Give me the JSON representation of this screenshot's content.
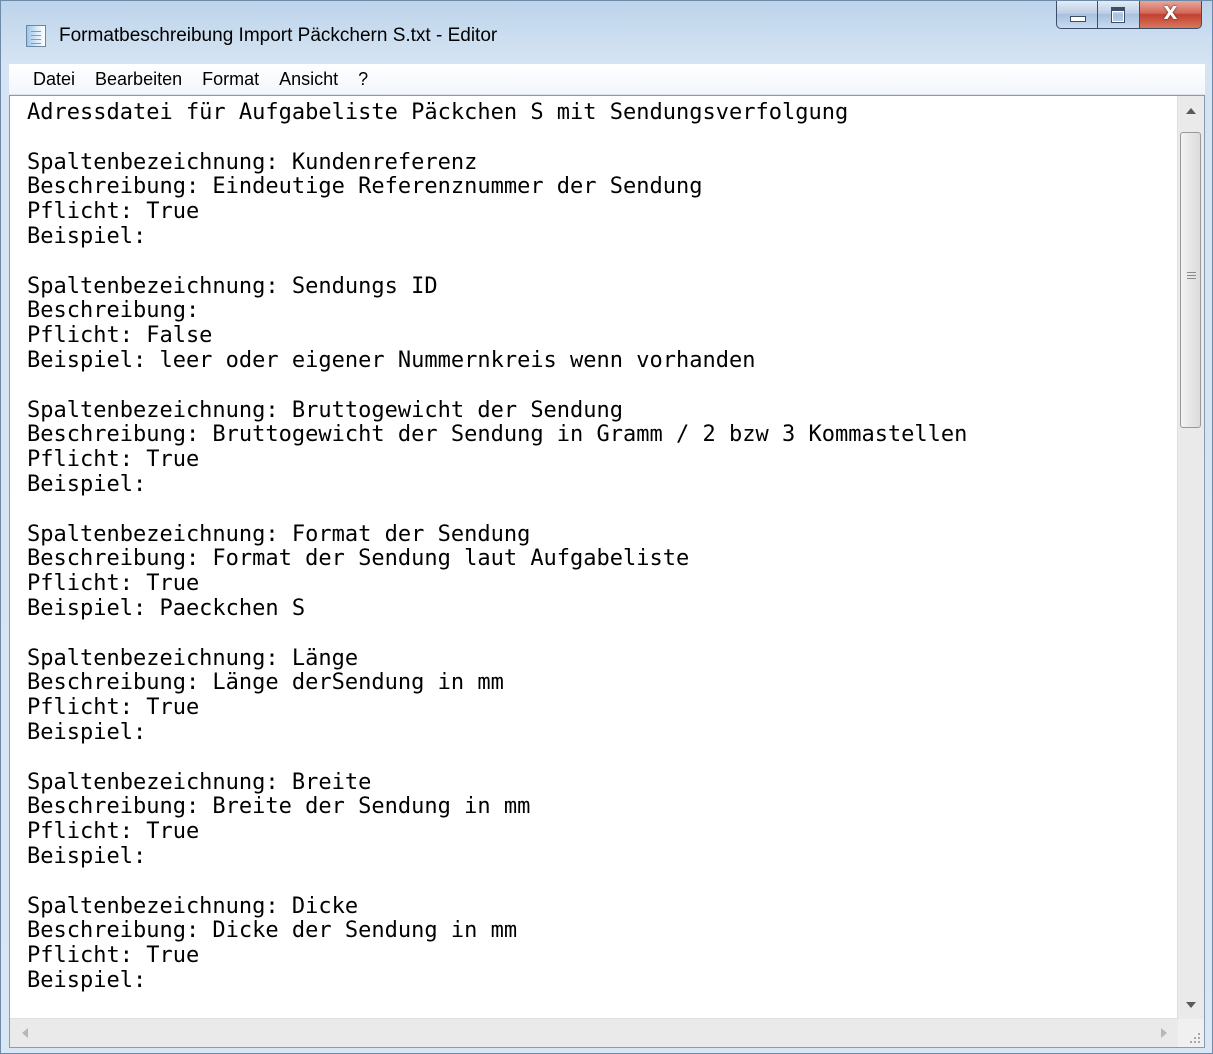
{
  "window": {
    "title": "Formatbeschreibung Import Päckchern S.txt - Editor",
    "close_glyph": "X"
  },
  "menu": {
    "items": [
      {
        "label": "Datei"
      },
      {
        "label": "Bearbeiten"
      },
      {
        "label": "Format"
      },
      {
        "label": "Ansicht"
      },
      {
        "label": "?"
      }
    ]
  },
  "document": {
    "lines": [
      "Adressdatei für Aufgabeliste Päckchen S mit Sendungsverfolgung",
      "",
      "Spaltenbezeichnung: Kundenreferenz",
      "Beschreibung: Eindeutige Referenznummer der Sendung",
      "Pflicht: True",
      "Beispiel:",
      "",
      "Spaltenbezeichnung: Sendungs ID",
      "Beschreibung:",
      "Pflicht: False",
      "Beispiel: leer oder eigener Nummernkreis wenn vorhanden",
      "",
      "Spaltenbezeichnung: Bruttogewicht der Sendung",
      "Beschreibung: Bruttogewicht der Sendung in Gramm / 2 bzw 3 Kommastellen",
      "Pflicht: True",
      "Beispiel:",
      "",
      "Spaltenbezeichnung: Format der Sendung",
      "Beschreibung: Format der Sendung laut Aufgabeliste",
      "Pflicht: True",
      "Beispiel: Paeckchen S",
      "",
      "Spaltenbezeichnung: Länge",
      "Beschreibung: Länge derSendung in mm",
      "Pflicht: True",
      "Beispiel:",
      "",
      "Spaltenbezeichnung: Breite",
      "Beschreibung: Breite der Sendung in mm",
      "Pflicht: True",
      "Beispiel:",
      "",
      "Spaltenbezeichnung: Dicke",
      "Beschreibung: Dicke der Sendung in mm",
      "Pflicht: True",
      "Beispiel:"
    ]
  },
  "colors": {
    "titlebar": "#c9dcef",
    "close_button": "#c2402e",
    "editor_background": "#ffffff",
    "text": "#000000"
  }
}
